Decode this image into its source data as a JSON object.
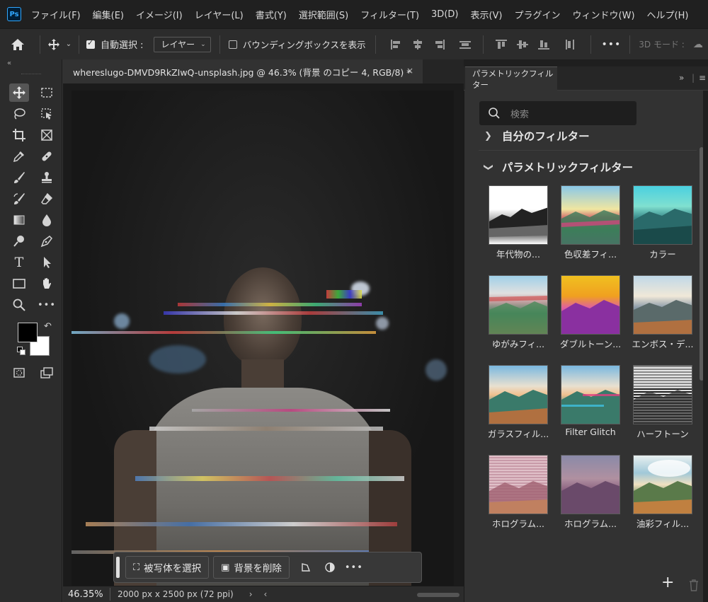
{
  "app": {
    "logo": "Ps"
  },
  "menu": [
    "ファイル(F)",
    "編集(E)",
    "イメージ(I)",
    "レイヤー(L)",
    "書式(Y)",
    "選択範囲(S)",
    "フィルター(T)",
    "3D(D)",
    "表示(V)",
    "プラグイン",
    "ウィンドウ(W)",
    "ヘルプ(H)"
  ],
  "options": {
    "home_icon": "home-icon",
    "move_icon": "move-icon",
    "auto_select_label": "自動選択 :",
    "auto_select_checked": true,
    "auto_select_value": "レイヤー",
    "bounding_box_label": "バウンディングボックスを表示",
    "bounding_box_checked": false,
    "more": "•••",
    "mode_3d": "3D モード :"
  },
  "document": {
    "tab_title": "whereslugo-DMVD9RkZIwQ-unsplash.jpg @ 46.3% (背景 のコピー 4, RGB/8) *",
    "close": "×",
    "zoom": "46.35%",
    "size_info": "2000 px x 2500 px (72 ppi)",
    "status_arrow": "›",
    "scroll_arrow": "‹"
  },
  "taskbar": {
    "select_subject": "被写体を選択",
    "remove_bg": "背景を削除",
    "more": "•••"
  },
  "panel": {
    "tab_title": "パラメトリックフィルター",
    "expand": "»",
    "menu": "≡",
    "search_placeholder": "検索",
    "my_filters": "自分のフィルター",
    "parametric_filters": "パラメトリックフィルター",
    "filters": [
      {
        "label": "年代物の..."
      },
      {
        "label": "色収差フィ..."
      },
      {
        "label": "カラー"
      },
      {
        "label": "ゆがみフィ..."
      },
      {
        "label": "ダブルトーン..."
      },
      {
        "label": "エンボス・デ..."
      },
      {
        "label": "ガラスフィル..."
      },
      {
        "label": "Filter Glitch"
      },
      {
        "label": "ハーフトーン"
      },
      {
        "label": "ホログラム..."
      },
      {
        "label": "ホログラム..."
      },
      {
        "label": "油彩フィル..."
      }
    ],
    "add": "+",
    "delete_icon": "trash-icon"
  },
  "colors": {
    "foreground": "#000000",
    "background": "#ffffff",
    "accent": "#31a8ff"
  }
}
